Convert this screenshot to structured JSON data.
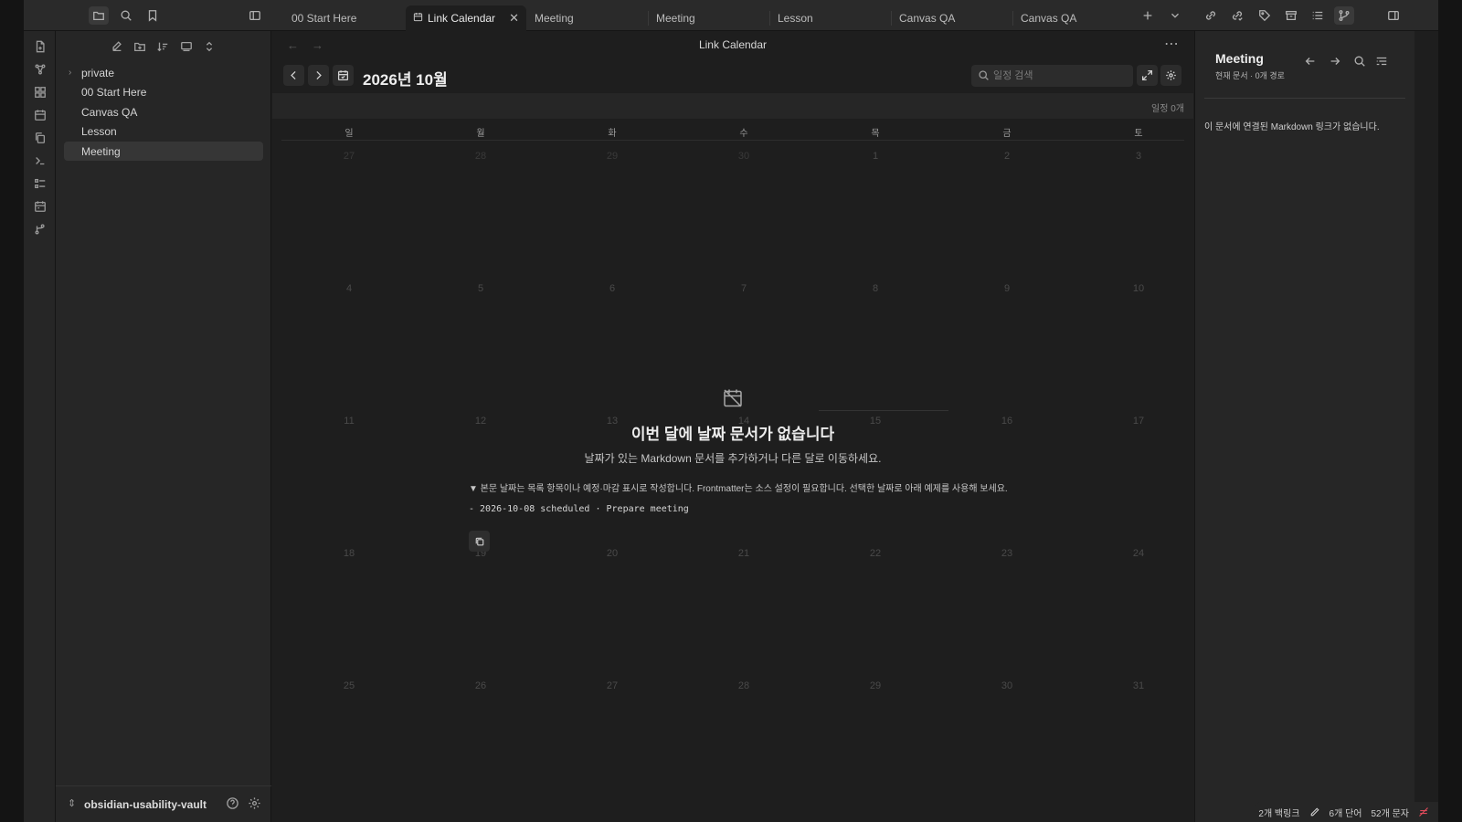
{
  "tabs": [
    {
      "label": "00 Start Here"
    },
    {
      "label": "Link Calendar"
    },
    {
      "label": "Meeting"
    },
    {
      "label": "Meeting"
    },
    {
      "label": "Lesson"
    },
    {
      "label": "Canvas QA"
    },
    {
      "label": "Canvas QA"
    }
  ],
  "explorer": {
    "items": [
      {
        "label": "private"
      },
      {
        "label": "00 Start Here"
      },
      {
        "label": "Canvas QA"
      },
      {
        "label": "Lesson"
      },
      {
        "label": "Meeting"
      }
    ],
    "vault_name": "obsidian-usability-vault"
  },
  "main": {
    "view_title": "Link Calendar",
    "month_title": "2026년 10월",
    "search_placeholder": "일정 검색",
    "event_count": "일정 0개",
    "weekdays": [
      "일",
      "월",
      "화",
      "수",
      "목",
      "금",
      "토"
    ],
    "weeks": [
      [
        "27",
        "28",
        "29",
        "30",
        "1",
        "2",
        "3"
      ],
      [
        "4",
        "5",
        "6",
        "7",
        "8",
        "9",
        "10"
      ],
      [
        "11",
        "12",
        "13",
        "14",
        "15",
        "16",
        "17"
      ],
      [
        "18",
        "19",
        "20",
        "21",
        "22",
        "23",
        "24"
      ],
      [
        "25",
        "26",
        "27",
        "28",
        "29",
        "30",
        "31"
      ]
    ],
    "empty_title": "이번 달에 날짜 문서가 없습니다",
    "empty_sub": "날짜가 있는 Markdown 문서를 추가하거나 다른 달로 이동하세요.",
    "hint": "▼ 본문 날짜는 목록 항목이나 예정·마감 표시로 작성합니다. Frontmatter는 소스 설정이 필요합니다. 선택한 날짜로 아래 예제를 사용해 보세요.",
    "code_example": "- 2026-10-08 scheduled · Prepare meeting"
  },
  "right_panel": {
    "title": "Meeting",
    "subtitle": "현재 문서 · 0개 경로",
    "message": "이 문서에 연결된 Markdown 링크가 없습니다."
  },
  "status_bar": {
    "backlinks": "2개 백링크",
    "words": "6개 단어",
    "chars": "52개 문자"
  },
  "colors": {
    "background": "#1e1e1e",
    "sidebar": "#262626",
    "sync_error": "#e04a5a"
  }
}
